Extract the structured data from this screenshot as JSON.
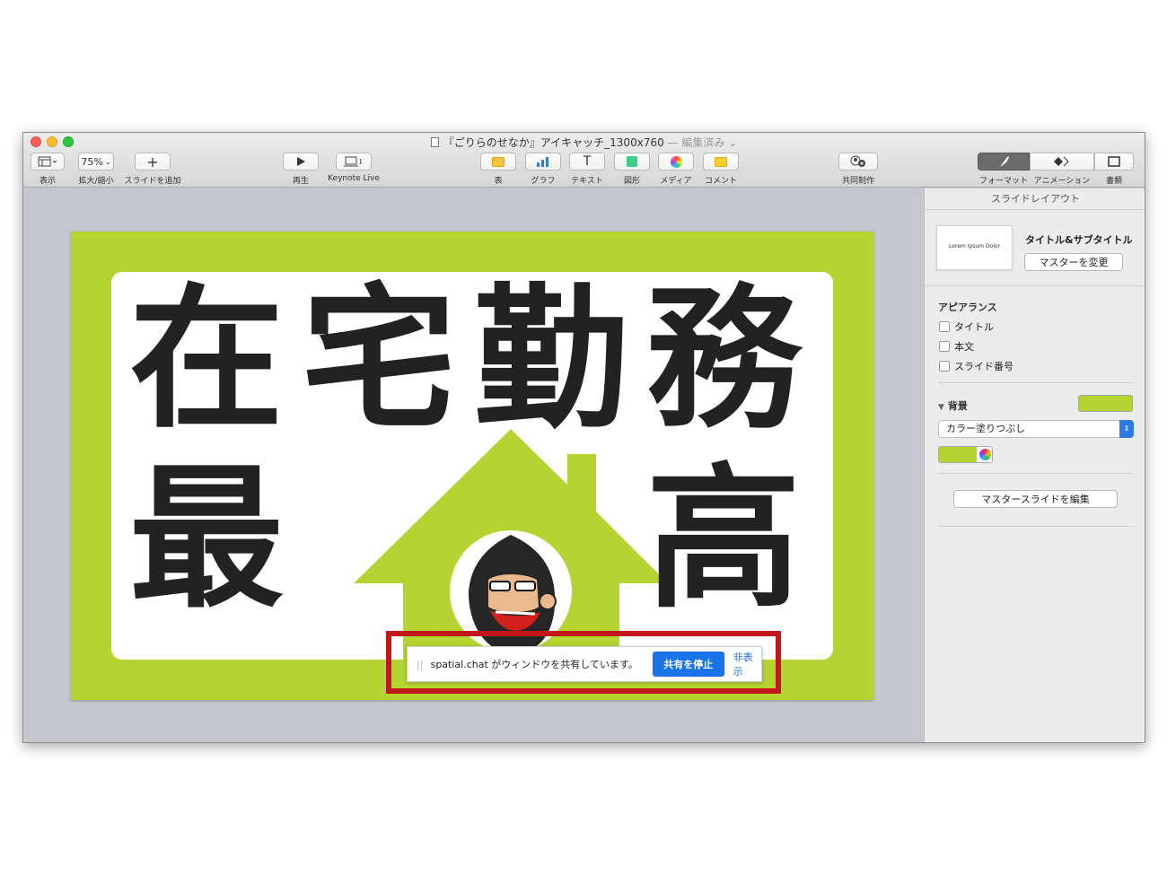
{
  "window": {
    "title": "『ごりらのせなか』アイキャッチ_1300x760",
    "title_suffix": "— 編集済み ⌄"
  },
  "toolbar": {
    "view_label": "表示",
    "zoom_value": "75%",
    "zoom_label": "拡大/縮小",
    "add_slide_label": "スライドを追加",
    "play_label": "再生",
    "keynote_live_label": "Keynote Live",
    "table_label": "表",
    "chart_label": "グラフ",
    "text_label": "テキスト",
    "shape_label": "図形",
    "media_label": "メディア",
    "comment_label": "コメント",
    "collab_label": "共同制作",
    "format_label": "フォーマット",
    "animate_label": "アニメーション",
    "document_label": "書類"
  },
  "slide": {
    "chars": [
      "在",
      "宅",
      "勤",
      "務",
      "最",
      "高"
    ],
    "background_color": "#b4d431",
    "text_color": "#222222"
  },
  "sharing_bar": {
    "grip": "||",
    "message": "spatial.chat がウィンドウを共有しています。",
    "stop_label": "共有を停止",
    "hide_label": "非表示"
  },
  "inspector": {
    "header": "スライドレイアウト",
    "thumb_text": "Lorem Ipsum Dolor",
    "layout_name": "タイトル&サブタイトル",
    "change_master_label": "マスターを変更",
    "appearance_title": "アピアランス",
    "checkboxes": [
      "タイトル",
      "本文",
      "スライド番号"
    ],
    "background_title": "背景",
    "fill_type": "カラー塗りつぶし",
    "edit_master_label": "マスタースライドを編集",
    "accent_color": "#2b7be4"
  }
}
